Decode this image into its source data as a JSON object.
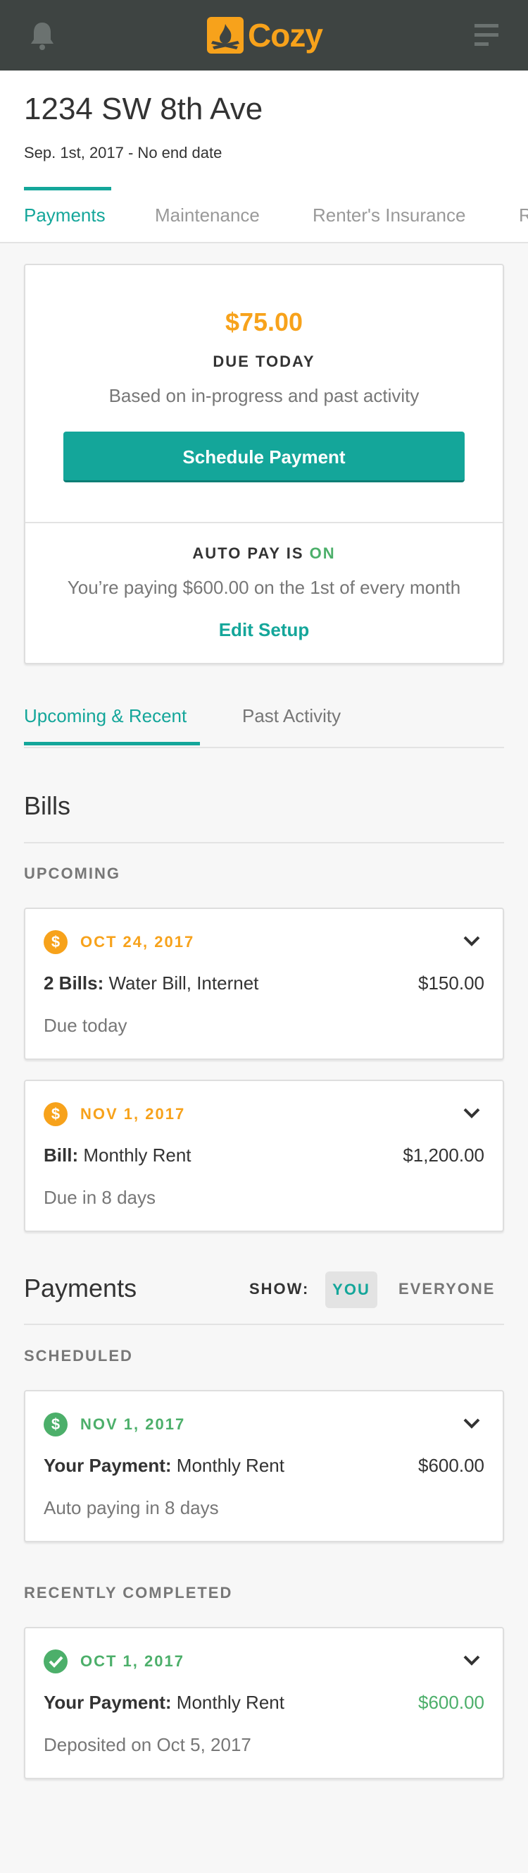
{
  "header": {
    "brand": "Cozy",
    "bell_icon": "bell-icon",
    "menu_icon": "hamburger-menu-icon",
    "brand_color": "#f7a21b",
    "bar_color": "#3e4442"
  },
  "property": {
    "address": "1234 SW 8th Ave",
    "dates": "Sep. 1st, 2017 - No end date"
  },
  "tabs": [
    {
      "label": "Payments",
      "active": true
    },
    {
      "label": "Maintenance",
      "active": false
    },
    {
      "label": "Renter's Insurance",
      "active": false
    },
    {
      "label": "R",
      "active": false
    }
  ],
  "due": {
    "amount": "$75.00",
    "label": "DUE TODAY",
    "subtext": "Based on in-progress and past activity",
    "button": "Schedule Payment",
    "autopay_prefix": "AUTO PAY IS",
    "autopay_state": "ON",
    "autopay_text": "You’re paying $600.00 on the 1st of every month",
    "edit_link": "Edit Setup"
  },
  "subtabs": [
    {
      "label": "Upcoming & Recent",
      "active": true
    },
    {
      "label": "Past Activity",
      "active": false
    }
  ],
  "bills": {
    "title": "Bills",
    "upcoming_label": "UPCOMING",
    "items": [
      {
        "date": "OCT 24, 2017",
        "title_bold": "2 Bills:",
        "title": "Water Bill, Internet",
        "amount": "$150.00",
        "status": "Due today",
        "icon": "$"
      },
      {
        "date": "NOV 1, 2017",
        "title_bold": "Bill:",
        "title": "Monthly Rent",
        "amount": "$1,200.00",
        "status": "Due in 8 days",
        "icon": "$"
      }
    ]
  },
  "payments": {
    "title": "Payments",
    "show_label": "SHOW:",
    "show_you": "YOU",
    "show_everyone": "EVERYONE",
    "scheduled_label": "SCHEDULED",
    "scheduled": {
      "date": "NOV 1, 2017",
      "title_bold": "Your Payment:",
      "title": "Monthly Rent",
      "amount": "$600.00",
      "status": "Auto paying in 8 days",
      "icon": "$"
    },
    "completed_label": "RECENTLY COMPLETED",
    "completed": {
      "date": "OCT 1, 2017",
      "title_bold": "Your Payment:",
      "title": "Monthly Rent",
      "amount": "$600.00",
      "status": "Deposited on Oct 5, 2017",
      "icon": "check"
    }
  },
  "colors": {
    "accent": "#14a69a",
    "warning": "#f7a21b",
    "success": "#4caf6a"
  }
}
